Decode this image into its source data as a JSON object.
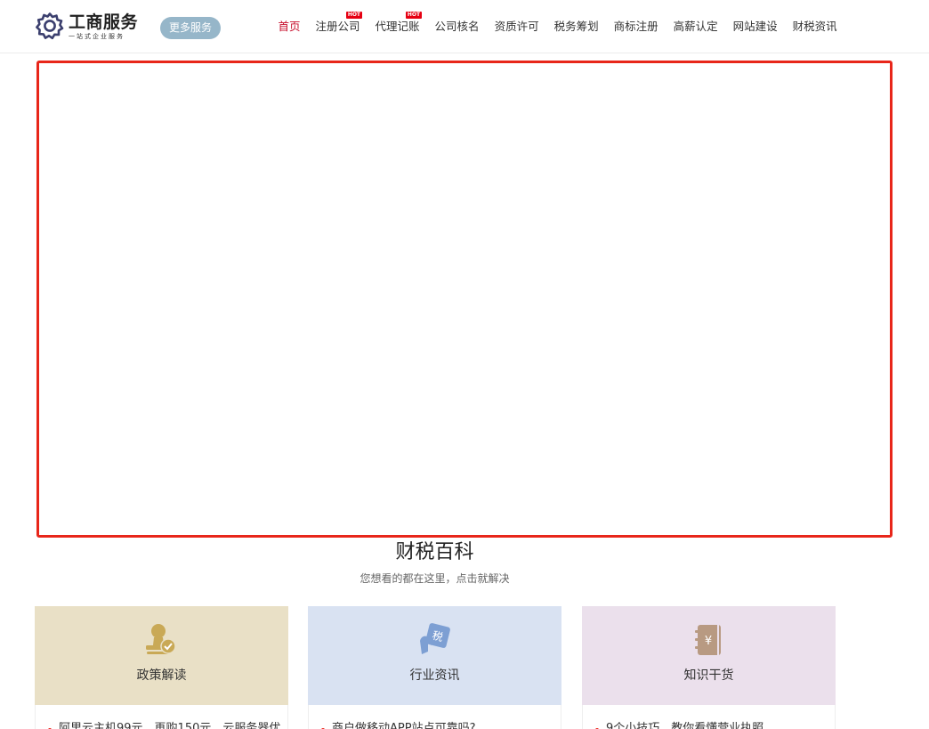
{
  "header": {
    "logo_title": "工商服务",
    "logo_subtitle": "一站式企业服务",
    "more_button": "更多服务",
    "hot_badge": "HOT",
    "nav": [
      {
        "label": "首页",
        "active": true,
        "hot": false
      },
      {
        "label": "注册公司",
        "active": false,
        "hot": true
      },
      {
        "label": "代理记账",
        "active": false,
        "hot": true
      },
      {
        "label": "公司核名",
        "active": false,
        "hot": false
      },
      {
        "label": "资质许可",
        "active": false,
        "hot": false
      },
      {
        "label": "税务筹划",
        "active": false,
        "hot": false
      },
      {
        "label": "商标注册",
        "active": false,
        "hot": false
      },
      {
        "label": "高薪认定",
        "active": false,
        "hot": false
      },
      {
        "label": "网站建设",
        "active": false,
        "hot": false
      },
      {
        "label": "财税资讯",
        "active": false,
        "hot": false
      }
    ]
  },
  "section": {
    "title": "财税百科",
    "subtitle": "您想看的都在这里，点击就解决"
  },
  "cards": [
    {
      "label": "政策解读",
      "icon": "stamp-icon",
      "bg": "#e9e0c6",
      "first_item": "阿里云主机99元，再购150元，云服务器优"
    },
    {
      "label": "行业资讯",
      "icon": "tax-document-icon",
      "bg": "#d9e2f2",
      "first_item": "商户做移动APP站点可靠吗?"
    },
    {
      "label": "知识干货",
      "icon": "notebook-icon",
      "bg": "#ebe0ec",
      "first_item": "9个小技巧，教你看懂营业执照"
    }
  ],
  "colors": {
    "nav_active": "#c8102e",
    "banner_border": "#e8261a",
    "more_button_bg": "#96b6c9",
    "hot_badge": "#e60012"
  }
}
